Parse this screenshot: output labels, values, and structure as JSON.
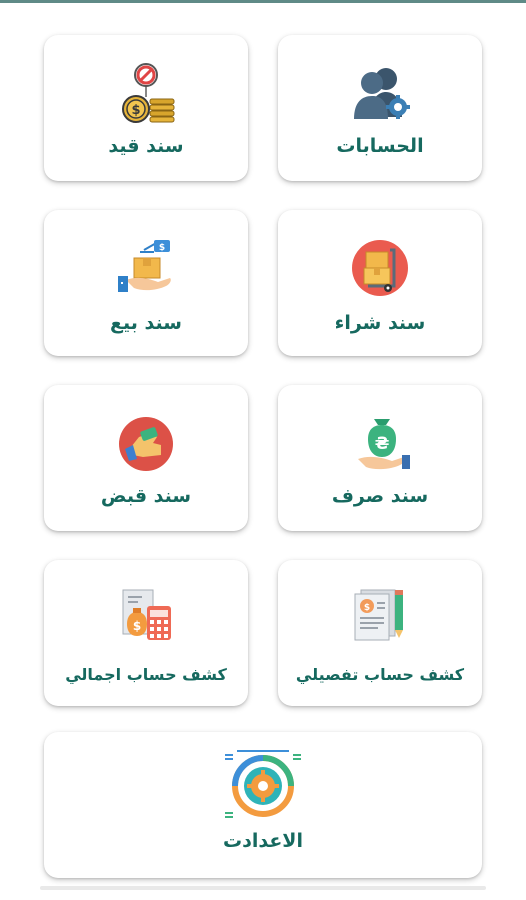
{
  "menu": {
    "accounts": {
      "label": "الحسابات",
      "icon": "accounts-users-gear-icon"
    },
    "journal_voucher": {
      "label": "سند قيد",
      "icon": "coins-blocked-icon"
    },
    "purchase_voucher": {
      "label": "سند شراء",
      "icon": "cart-boxes-icon"
    },
    "sales_voucher": {
      "label": "سند بيع",
      "icon": "hand-box-tag-icon"
    },
    "payment_voucher": {
      "label": "سند صرف",
      "icon": "hand-money-bag-icon"
    },
    "receipt_voucher": {
      "label": "سند قبض",
      "icon": "hand-receive-icon"
    },
    "detailed_statement": {
      "label": "كشف حساب تفصيلي",
      "icon": "document-pencil-icon"
    },
    "summary_statement": {
      "label": "كشف حساب اجمالي",
      "icon": "invoice-calculator-icon"
    },
    "settings": {
      "label": "الاعدادت",
      "icon": "settings-gear-chart-icon"
    }
  },
  "colors": {
    "label": "#16695f",
    "topline": "#5f8a87"
  }
}
